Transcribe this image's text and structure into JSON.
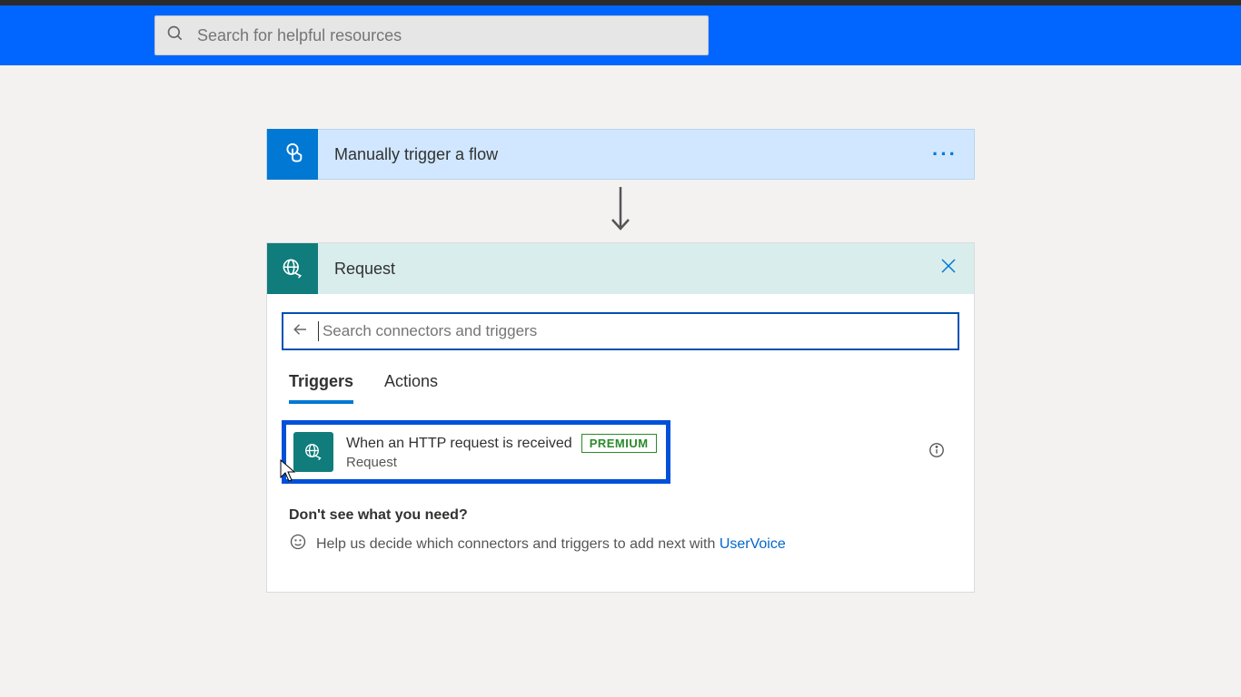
{
  "header": {
    "search_placeholder": "Search for helpful resources"
  },
  "trigger_card": {
    "title": "Manually trigger a flow"
  },
  "request_panel": {
    "title": "Request",
    "search_placeholder": "Search connectors and triggers",
    "tabs": {
      "triggers": "Triggers",
      "actions": "Actions"
    },
    "result": {
      "title": "When an HTTP request is received",
      "badge": "PREMIUM",
      "connector": "Request"
    },
    "footer": {
      "question": "Don't see what you need?",
      "help_text": "Help us decide which connectors and triggers to add next with ",
      "link": "UserVoice"
    }
  }
}
